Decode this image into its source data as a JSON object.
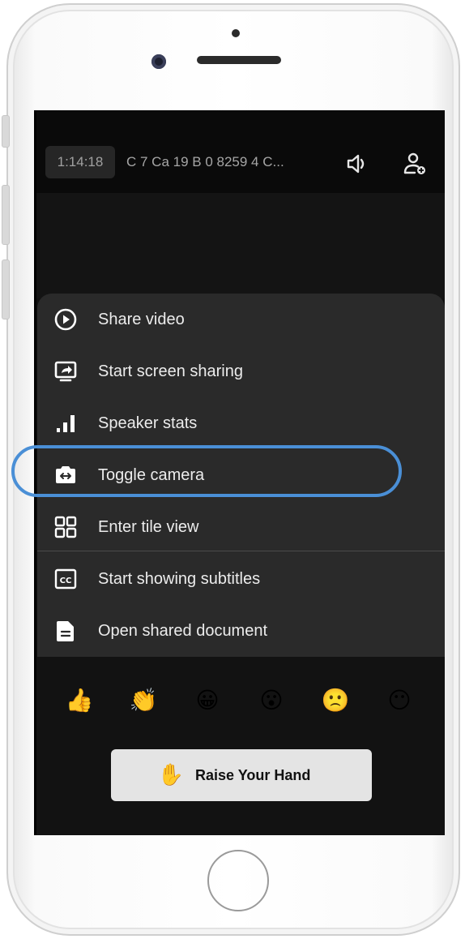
{
  "topbar": {
    "timer": "1:14:18",
    "room_name": "C 7 Ca 19 B 0 8259 4 C...",
    "speaker_icon": "speaker-icon",
    "add_participant_icon": "add-person-icon"
  },
  "menu": {
    "items": [
      {
        "label": "Share video",
        "icon": "play-circle-icon"
      },
      {
        "label": "Start screen sharing",
        "icon": "screen-share-icon"
      },
      {
        "label": "Speaker stats",
        "icon": "bar-stats-icon"
      },
      {
        "label": "Toggle camera",
        "icon": "camera-switch-icon",
        "highlighted": true
      },
      {
        "label": "Enter tile view",
        "icon": "tile-grid-icon"
      },
      {
        "label": "Start showing subtitles",
        "icon": "closed-captions-icon"
      },
      {
        "label": "Open shared document",
        "icon": "document-icon"
      }
    ]
  },
  "reactions": {
    "emojis": [
      "👍",
      "👏",
      "😀",
      "😮",
      "🙁",
      "😶"
    ],
    "raise_hand": {
      "emoji": "✋",
      "label": "Raise Your Hand"
    }
  },
  "colors": {
    "highlight": "#4a8fd6",
    "sheet_bg": "#2a2a2a",
    "screen_bg": "#111111"
  }
}
